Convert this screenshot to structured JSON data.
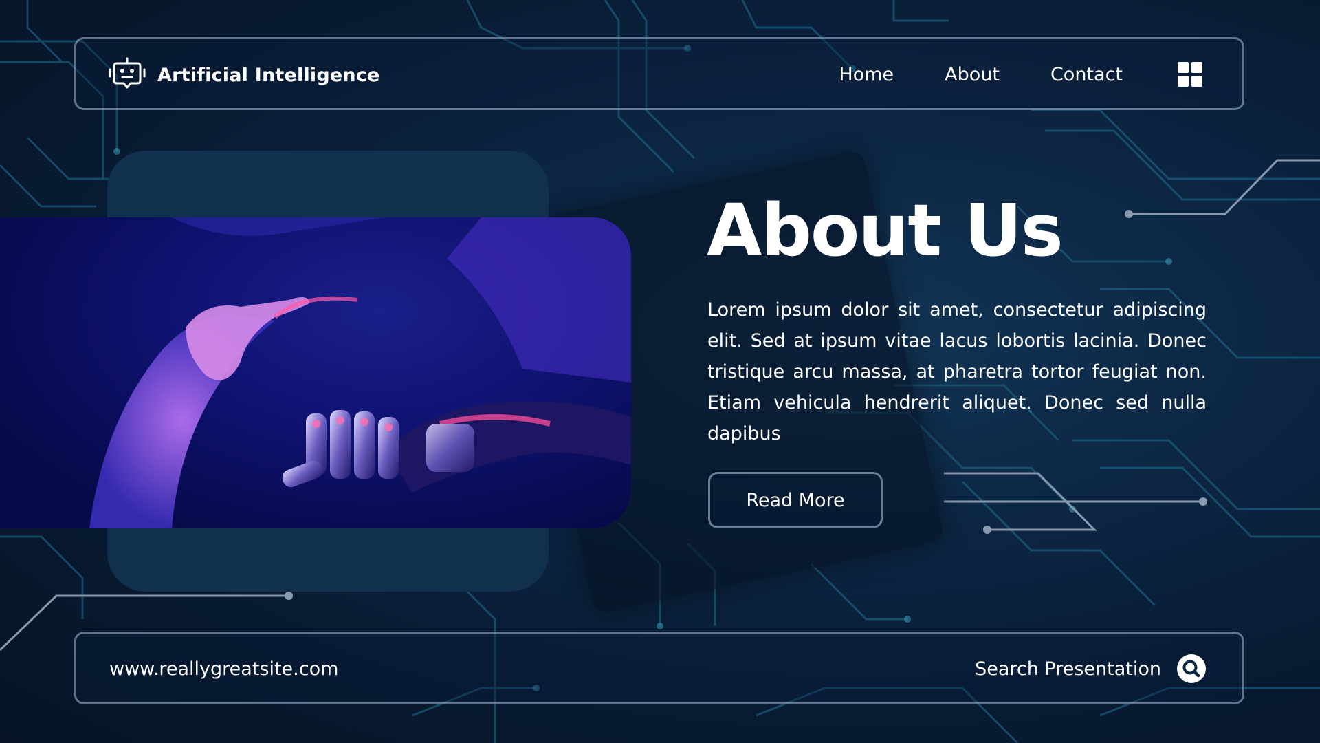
{
  "header": {
    "brand_name": "Artificial Intelligence",
    "brand_icon": "robot-chat-icon",
    "nav": [
      {
        "label": "Home"
      },
      {
        "label": "About"
      },
      {
        "label": "Contact"
      }
    ],
    "menu_icon": "grid-icon"
  },
  "main": {
    "heading": "About Us",
    "body": "Lorem ipsum dolor sit amet, consectetur adipiscing elit. Sed at ipsum vitae lacus lobortis lacinia. Donec tristique arcu massa, at pharetra tortor feugiat non. Etiam vehicula hendrerit aliquet. Donec sed nulla dapibus",
    "button_label": "Read More",
    "image_icon": "robotic-hand-photo"
  },
  "footer": {
    "url": "www.reallygreatsite.com",
    "search_label": "Search Presentation",
    "search_icon": "search-icon"
  },
  "colors": {
    "background": "#0c2643",
    "panel": "#10304d",
    "border": "#aabed7",
    "text": "#ffffff",
    "circuit": "#1f6f92"
  }
}
